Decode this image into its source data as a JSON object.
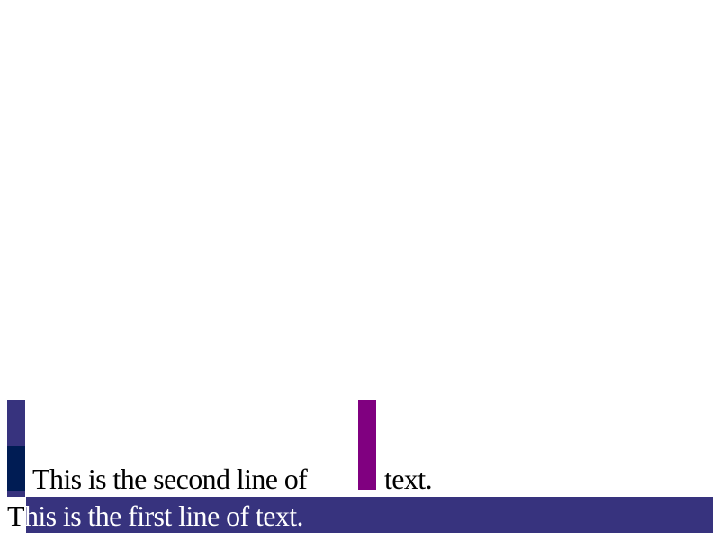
{
  "text": {
    "second_line_part1": "This is the second line of",
    "second_line_part2": "text.",
    "first_line_first_char": "T",
    "first_line_rest": "his is the first line of text."
  },
  "colors": {
    "left_outer_bar": "#37337e",
    "left_inner_bar": "#001c54",
    "middle_bar": "#800080",
    "bottom_band": "#37337e",
    "text": "#000000",
    "text_on_band": "#ffffff"
  }
}
